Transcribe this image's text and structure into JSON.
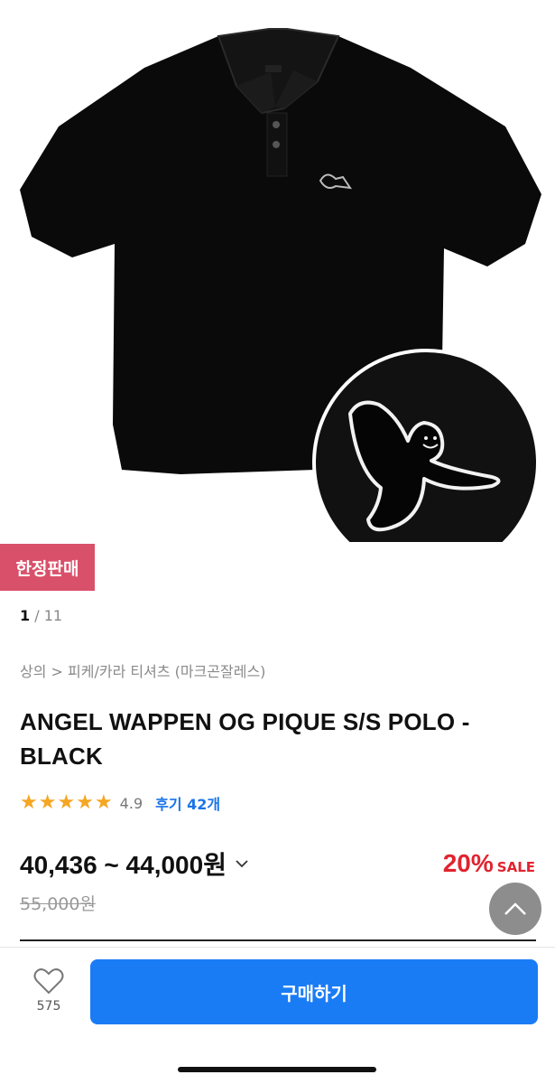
{
  "badge": {
    "limited": "한정판매"
  },
  "pager": {
    "current": "1",
    "separator": " / ",
    "total": "11"
  },
  "breadcrumb": {
    "text": "상의 > 피케/카라 티셔츠 (마크곤잘레스)"
  },
  "product": {
    "title": "ANGEL WAPPEN OG PIQUE S/S POLO - BLACK",
    "rating": {
      "stars": 5,
      "score": "4.9",
      "reviews": "후기 42개"
    },
    "price": "40,436 ~ 44,000원",
    "discount": "20%",
    "sale_label": "SALE",
    "original_price": "55,000원"
  },
  "actions": {
    "like_count": "575",
    "buy_label": "구매하기"
  },
  "colors": {
    "accent": "#1a7cf5",
    "badge": "#d9506a",
    "discount": "#e0242e",
    "star": "#f5a623"
  },
  "icons": [
    "chevron-down-icon",
    "chevron-up-icon",
    "heart-icon",
    "star-icon"
  ]
}
